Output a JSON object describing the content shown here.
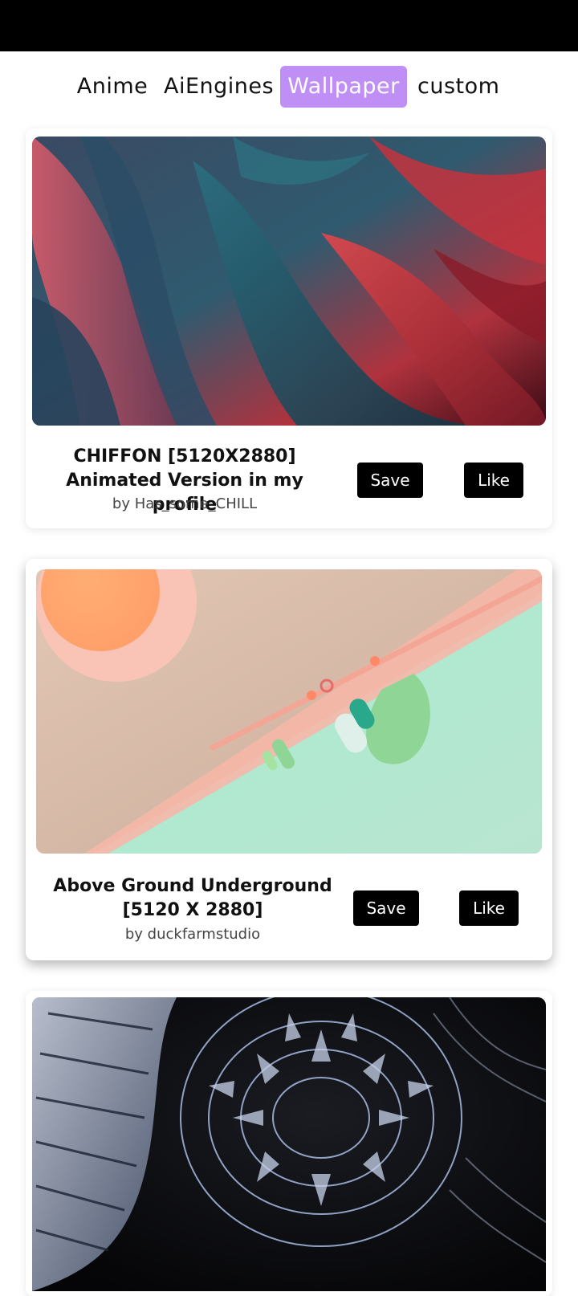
{
  "tabs": [
    {
      "label": "Anime",
      "active": false
    },
    {
      "label": "AiEngines",
      "active": false
    },
    {
      "label": "Wallpaper",
      "active": true
    },
    {
      "label": "custom",
      "active": false
    }
  ],
  "accent_color": "#bf8ff5",
  "cards": [
    {
      "title": "CHIFFON [5120X2880] Animated Version in my profile",
      "author": "by Has_some_CHILL",
      "save_label": "Save",
      "like_label": "Like",
      "image": "abstract-silk-red-blue"
    },
    {
      "title": "Above Ground Underground [5120 X 2880]",
      "author": "by duckfarmstudio",
      "save_label": "Save",
      "like_label": "Like",
      "image": "pastel-geometric-mint-peach"
    },
    {
      "title": "",
      "author": "",
      "save_label": "",
      "like_label": "",
      "image": "metallic-fractal-dark"
    }
  ]
}
